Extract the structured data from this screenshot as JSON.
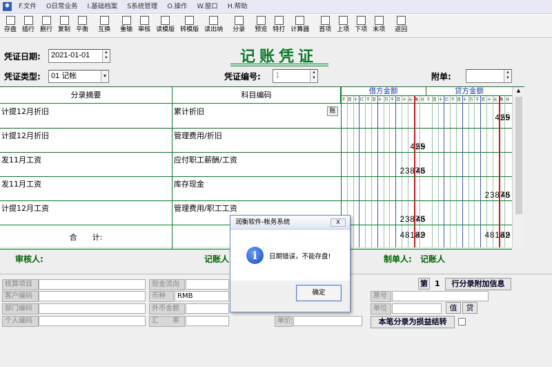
{
  "menu": [
    {
      "label": "F.文件"
    },
    {
      "label": "O日常业务"
    },
    {
      "label": "I.基础档案"
    },
    {
      "label": "S系统管理"
    },
    {
      "label": "O.操作"
    },
    {
      "label": "W.窗口"
    },
    {
      "label": "H.帮助"
    }
  ],
  "toolbar": [
    {
      "label": "存盘",
      "icon": "save-icon"
    },
    {
      "label": "插行",
      "icon": "insert-row-icon"
    },
    {
      "label": "删行",
      "icon": "delete-row-icon"
    },
    {
      "label": "复制",
      "icon": "copy-icon"
    },
    {
      "label": "平衡",
      "icon": "balance-icon"
    },
    {
      "label": "互换",
      "icon": "swap-icon"
    },
    {
      "label": "重输",
      "icon": "reenter-icon"
    },
    {
      "label": "审核",
      "icon": "audit-icon"
    },
    {
      "label": "读模版",
      "icon": "read-template-icon"
    },
    {
      "label": "转模版",
      "icon": "to-template-icon"
    },
    {
      "label": "读出纳",
      "icon": "read-cashier-icon"
    },
    {
      "label": "分录",
      "icon": "entry-icon"
    },
    {
      "label": "预览",
      "icon": "preview-icon"
    },
    {
      "label": "特打",
      "icon": "print-icon"
    },
    {
      "label": "计算器",
      "icon": "calculator-icon"
    },
    {
      "label": "首项",
      "icon": "first-icon"
    },
    {
      "label": "上项",
      "icon": "prev-icon"
    },
    {
      "label": "下项",
      "icon": "next-icon"
    },
    {
      "label": "末项",
      "icon": "last-icon"
    },
    {
      "label": "返回",
      "icon": "return-icon"
    }
  ],
  "header": {
    "date_label": "凭证日期:",
    "date_value": "2021-01-01",
    "title": "记账凭证",
    "type_label": "凭证类型:",
    "type_value": "01 记帐",
    "number_label": "凭证编号:",
    "number_value": "1",
    "attach_label": "附单:",
    "attach_value": ""
  },
  "table": {
    "col_summary": "分录摘要",
    "col_account": "科目编码",
    "col_debit": "借方金额",
    "col_credit": "贷方金额",
    "digit_heads": [
      "千",
      "百",
      "十",
      "亿",
      "千",
      "百",
      "十",
      "万",
      "千",
      "百",
      "十",
      "元",
      "角",
      "分"
    ],
    "rows": [
      {
        "summary": "计提12月折旧",
        "account": "累计折旧",
        "debit": "",
        "debit_cents": "",
        "credit": "425",
        "credit_cents": "59",
        "book_btn": "账"
      },
      {
        "summary": "计提12月折旧",
        "account": "管理费用/折旧",
        "debit": "425",
        "debit_cents": "59",
        "credit": "",
        "credit_cents": ""
      },
      {
        "summary": "发11月工资",
        "account": "应付职工薪酬/工资",
        "debit": "23878",
        "debit_cents": "45",
        "credit": "",
        "credit_cents": ""
      },
      {
        "summary": "发11月工资",
        "account": "库存现金",
        "debit": "",
        "debit_cents": "",
        "credit": "23878",
        "credit_cents": "45"
      },
      {
        "summary": "计提12月工资",
        "account": "管理费用/职工工资",
        "debit": "23878",
        "debit_cents": "45",
        "credit": "",
        "credit_cents": ""
      }
    ],
    "total_label": "合　　计:",
    "total_debit": "48182",
    "total_debit_cents": "49",
    "total_credit": "48182",
    "total_credit_cents": "49"
  },
  "signatures": {
    "auditor_label": "审核人:",
    "bookkeeper_label": "记账人:",
    "bookkeeper_value": "记账人",
    "maker_label": "制单人:",
    "maker_value": "记账人"
  },
  "bottom": {
    "project": "核算项目",
    "cashflow": "现金流向",
    "customer": "客户编码",
    "currency": "币种",
    "currency_value": "RMB",
    "dept": "部门编码",
    "foreign_amount": "外币金额",
    "person": "个人编码",
    "rate": "汇　　率",
    "price": "单价",
    "ticket": "票号",
    "unit": "单位",
    "page_label": "第",
    "page_value": "1",
    "extra_btn": "行分录附加信息",
    "qty_btn": "值",
    "inv_btn": "贷",
    "settle_btn": "本笔分录为损益结转"
  },
  "dialog": {
    "title": "润衡软件-帐务系统",
    "message": "日期错误，不能存盘!",
    "ok": "确定",
    "close": "X"
  }
}
